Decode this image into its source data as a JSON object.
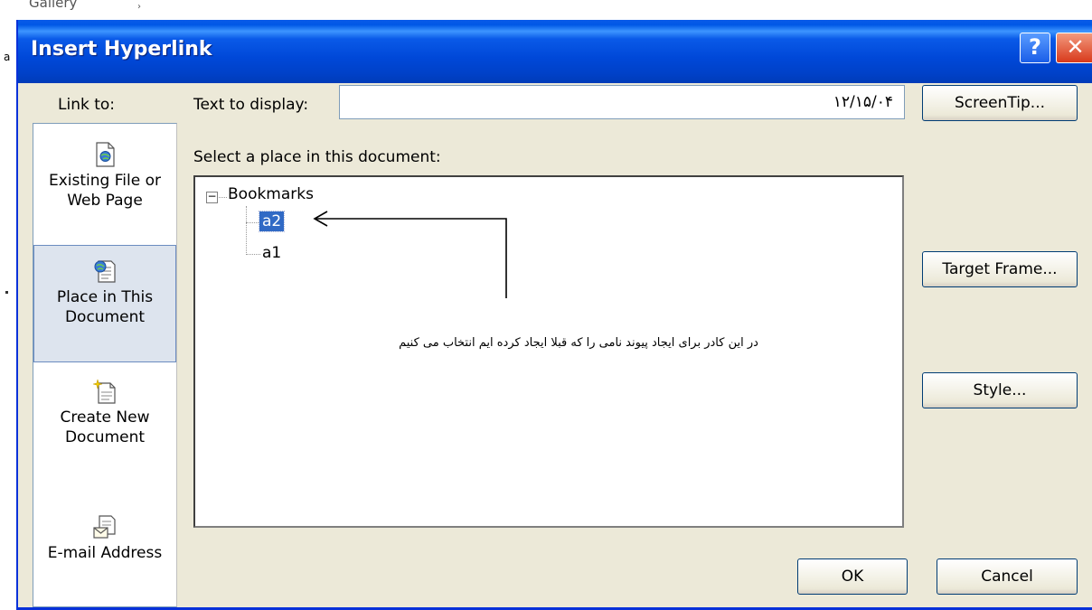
{
  "background": {
    "menu_fragment": "Gallery",
    "menu_arrow": "›",
    "left_mark": "a"
  },
  "dialog": {
    "title": "Insert Hyperlink",
    "help_glyph": "?",
    "close_glyph": "✕"
  },
  "link_to": {
    "label": "Link to:",
    "items": [
      {
        "line1": "Existing File or",
        "line2": "Web Page",
        "icon": "existing-file-icon",
        "selected": false
      },
      {
        "line1": "Place in This",
        "line2": "Document",
        "icon": "place-in-document-icon",
        "selected": true
      },
      {
        "line1": "Create New",
        "line2": "Document",
        "icon": "create-new-document-icon",
        "selected": false
      },
      {
        "line1": "E-mail Address",
        "line2": "",
        "icon": "email-address-icon",
        "selected": false
      }
    ]
  },
  "text_to_display": {
    "label": "Text to display:",
    "value": "۱۲/۱۵/۰۴"
  },
  "place_list": {
    "label": "Select a place in this document:",
    "root": "Bookmarks",
    "expander": "−",
    "bookmarks": [
      "a2",
      "a1"
    ],
    "selected": "a2"
  },
  "annotation": {
    "text": "در این کادر برای ایجاد پیوند نامی را که قبلا ایجاد کرده ایم انتخاب می کنیم"
  },
  "buttons": {
    "screentip": "ScreenTip...",
    "target_frame": "Target Frame...",
    "style": "Style...",
    "ok": "OK",
    "cancel": "Cancel"
  },
  "colors": {
    "titlebar": "#0a5ae8",
    "dialog_face": "#ece9d8",
    "selection": "#316ac5",
    "close_button": "#d8391b"
  }
}
